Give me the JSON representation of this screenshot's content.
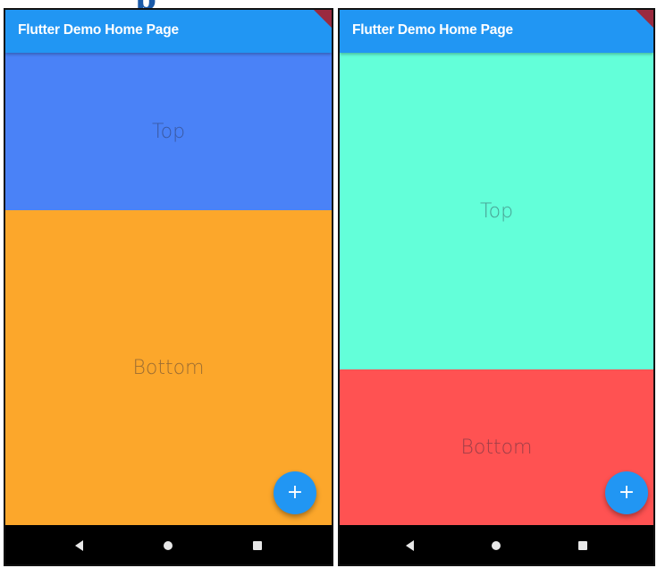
{
  "colors": {
    "app_bar": "#2196f3",
    "fab": "#2196f3",
    "nav_bar": "#000000",
    "debug_banner": "#9a2a3f"
  },
  "phones": [
    {
      "app_title": "Flutter Demo Home Page",
      "top_label": "Top",
      "bottom_label": "Bottom",
      "top_color": "#4a82f7",
      "bottom_color": "#fca72b",
      "fab_label": "+",
      "nav_icons": [
        "back-icon",
        "home-icon",
        "recent-apps-icon"
      ]
    },
    {
      "app_title": "Flutter Demo Home Page",
      "top_label": "Top",
      "bottom_label": "Bottom",
      "top_color": "#63ffd9",
      "bottom_color": "#ff5252",
      "fab_label": "+",
      "nav_icons": [
        "back-icon",
        "home-icon",
        "recent-apps-icon"
      ]
    }
  ]
}
